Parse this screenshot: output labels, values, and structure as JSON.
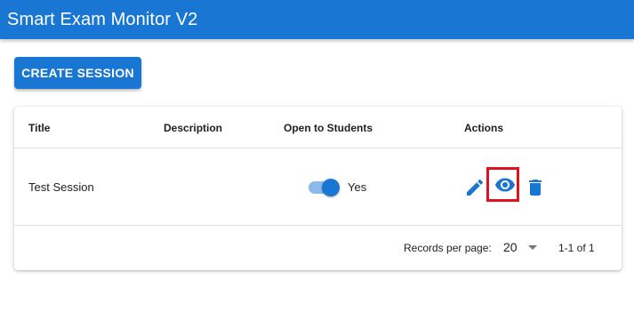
{
  "app": {
    "title": "Smart Exam Monitor V2"
  },
  "toolbar": {
    "create_label": "CREATE SESSION"
  },
  "table": {
    "headers": {
      "title": "Title",
      "description": "Description",
      "open": "Open to Students",
      "actions": "Actions"
    },
    "rows": [
      {
        "title": "Test Session",
        "description": "",
        "open_to_students": true,
        "open_label": "Yes",
        "actions": [
          "pencil-icon",
          "eye-icon",
          "trash-icon"
        ]
      }
    ]
  },
  "pagination": {
    "records_label": "Records per page:",
    "per_page": "20",
    "range": "1-1 of 1"
  },
  "colors": {
    "primary": "#1976d2",
    "switch_track": "#8ab9ea",
    "highlight": "#e3101d"
  }
}
